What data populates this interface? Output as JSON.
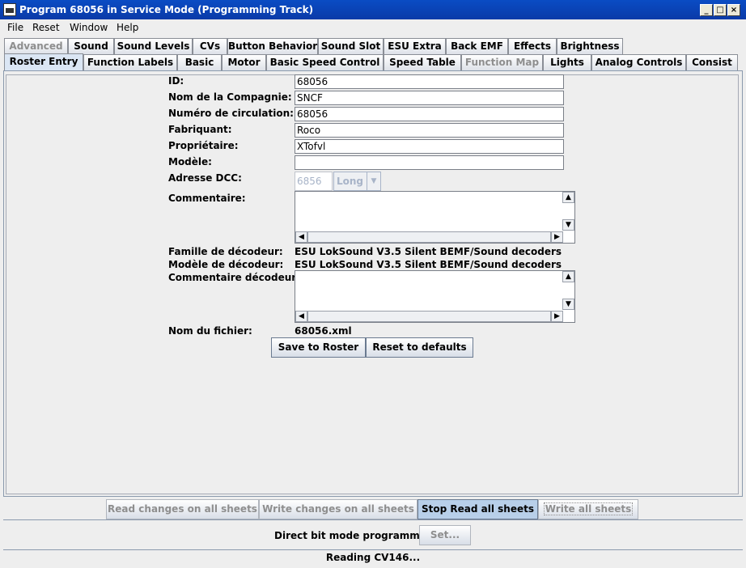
{
  "window": {
    "title": "Program 68056 in Service Mode (Programming Track)",
    "controls": {
      "minimize": "_",
      "maximize": "□",
      "close": "×"
    }
  },
  "menu": [
    "File",
    "Reset",
    "Window",
    "Help"
  ],
  "tabs_row1": [
    "Advanced",
    "Sound",
    "Sound Levels",
    "CVs",
    "Button Behavior",
    "Sound Slot",
    "ESU Extra",
    "Back EMF",
    "Effects",
    "Brightness"
  ],
  "tabs_row2": [
    "Roster Entry",
    "Function Labels",
    "Basic",
    "Motor",
    "Basic Speed Control",
    "Speed Table",
    "Function Map",
    "Lights",
    "Analog Controls",
    "Consist"
  ],
  "form": {
    "id_label": "ID:",
    "id_value": "68056",
    "company_label": "Nom de la Compagnie:",
    "company_value": "SNCF",
    "number_label": "Numéro de circulation:",
    "number_value": "68056",
    "maker_label": "Fabriquant:",
    "maker_value": "Roco",
    "owner_label": "Propriétaire:",
    "owner_value": "XTofvl",
    "model_label": "Modèle:",
    "model_value": "",
    "dcc_label": "Adresse DCC:",
    "dcc_value": "6856",
    "dcc_mode": "Long",
    "comment_label": "Commentaire:",
    "decoder_family_label": "Famille de décodeur:",
    "decoder_family_value": "ESU LokSound V3.5 Silent BEMF/Sound decoders",
    "decoder_model_label": "Modèle de décodeur:",
    "decoder_model_value": "ESU LokSound V3.5 Silent BEMF/Sound decoders",
    "decoder_comment_label": "Commentaire décodeur:",
    "filename_label": "Nom du fichier:",
    "filename_value": "68056.xml",
    "save_button": "Save to Roster",
    "reset_button": "Reset to defaults"
  },
  "bottom_buttons": {
    "read_changes": "Read changes on all sheets",
    "write_changes": "Write changes on all sheets",
    "stop_read": "Stop Read all sheets",
    "write_all": "Write all sheets"
  },
  "programming": {
    "mode_label": "Direct bit mode programming",
    "set_button": "Set..."
  },
  "status": "Reading CV146..."
}
